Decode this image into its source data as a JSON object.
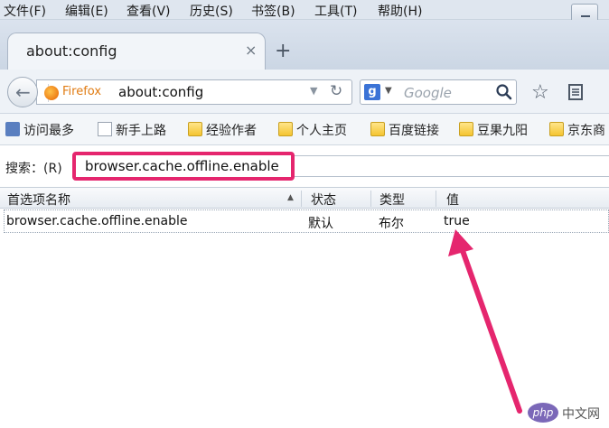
{
  "menu": {
    "items": [
      "文件(F)",
      "编辑(E)",
      "查看(V)",
      "历史(S)",
      "书签(B)",
      "工具(T)",
      "帮助(H)"
    ]
  },
  "tab": {
    "title": "about:config",
    "close": "×",
    "new_tab": "+"
  },
  "nav": {
    "identity_label": "Firefox",
    "url": "about:config",
    "search_engine_letter": "g",
    "search_placeholder": "Google"
  },
  "bookmarks": [
    "访问最多",
    "新手上路",
    "经验作者",
    "个人主页",
    "百度链接",
    "豆果九阳",
    "京东商"
  ],
  "config": {
    "search_label": "搜索：(R)",
    "filter_value": "browser.cache.offline.enable",
    "columns": [
      "首选项名称",
      "状态",
      "类型",
      "值"
    ],
    "row": {
      "name": "browser.cache.offline.enable",
      "status": "默认",
      "type": "布尔",
      "value": "true"
    }
  },
  "watermark": {
    "badge": "php",
    "text": "中文网"
  },
  "colors": {
    "highlight": "#e5266e",
    "firefox": "#e07b12"
  }
}
